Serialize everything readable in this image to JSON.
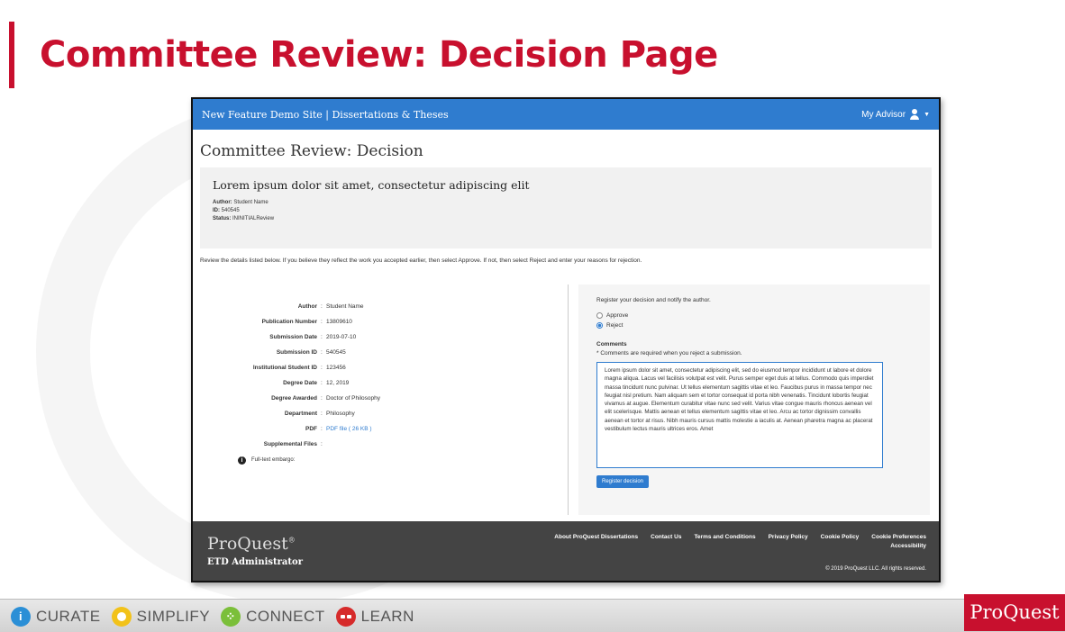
{
  "slide": {
    "title": "Committee Review: Decision Page"
  },
  "app": {
    "site_title": "New Feature Demo Site | Dissertations & Theses",
    "user_menu_label": "My Advisor",
    "page_heading": "Committee Review: Decision"
  },
  "submission": {
    "title": "Lorem ipsum dolor sit amet, consectetur adipiscing elit",
    "author_label": "Author:",
    "author_value": "Student Name",
    "id_label": "ID:",
    "id_value": "540545",
    "status_label": "Status:",
    "status_value": "ININITIALReview"
  },
  "instructions": "Review the details listed below. If you believe they reflect the work you accepted earlier, then select Approve. If not, then select Reject and enter your reasons for rejection.",
  "details": [
    {
      "label": "Author",
      "value": "Student Name"
    },
    {
      "label": "Publication Number",
      "value": "13809610"
    },
    {
      "label": "Submission Date",
      "value": "2019-07-10"
    },
    {
      "label": "Submission ID",
      "value": "540545"
    },
    {
      "label": "Institutional Student ID",
      "value": "123456"
    },
    {
      "label": "Degree Date",
      "value": "12, 2019"
    },
    {
      "label": "Degree Awarded",
      "value": "Doctor of Philosophy"
    },
    {
      "label": "Department",
      "value": "Philosophy"
    },
    {
      "label": "PDF",
      "value": "PDF file ( 26 KB )"
    },
    {
      "label": "Supplemental Files",
      "value": ""
    }
  ],
  "fulltext_label": "Full-text embargo",
  "decision": {
    "prompt": "Register your decision and notify the author.",
    "options": [
      {
        "label": "Approve",
        "checked": false
      },
      {
        "label": "Reject",
        "checked": true
      }
    ],
    "comments_label": "Comments",
    "required_note": "* Comments are required when you reject a submission.",
    "comment_text": "Lorem ipsum dolor sit amet, consectetur adipiscing elit, sed do eiusmod tempor incididunt ut labore et dolore magna aliqua. Lacus vel facilisis volutpat est velit. Purus semper eget duis at tellus. Commodo quis imperdiet massa tincidunt nunc pulvinar. Ut tellus elementum sagittis vitae et leo. Faucibus purus in massa tempor nec feugiat nisl pretium. Nam aliquam sem et tortor consequat id porta nibh venenatis. Tincidunt lobortis feugiat vivamus at augue. Elementum curabitur vitae nunc sed velit. Varius vitae congue mauris rhoncus aenean vel elit scelerisque. Mattis aenean et tellus elementum sagittis vitae et leo. Arcu ac tortor dignissim convallis aenean et tortor at risus. Nibh mauris cursus mattis molestie a iaculis at. Aenean pharetra magna ac placerat vestibulum lectus mauris ultrices eros. Amet",
    "register_button": "Register decision"
  },
  "footer": {
    "brand": "ProQuest",
    "brand_mark": "®",
    "product": "ETD Administrator",
    "links": [
      "About ProQuest Dissertations",
      "Contact Us",
      "Terms and Conditions",
      "Privacy Policy",
      "Cookie Policy",
      "Cookie Preferences"
    ],
    "accessibility": "Accessibility",
    "copyright": "© 2019 ProQuest LLC. All rights reserved."
  },
  "bottom_bar": {
    "pillars": [
      {
        "label": "CURATE",
        "icon": "info-icon",
        "color": "#2b8fd6"
      },
      {
        "label": "SIMPLIFY",
        "icon": "circle-icon",
        "color": "#f2c21a"
      },
      {
        "label": "CONNECT",
        "icon": "people-icon",
        "color": "#7bbf3a"
      },
      {
        "label": "LEARN",
        "icon": "glasses-icon",
        "color": "#d62b2b"
      }
    ],
    "brand": "ProQuest"
  }
}
